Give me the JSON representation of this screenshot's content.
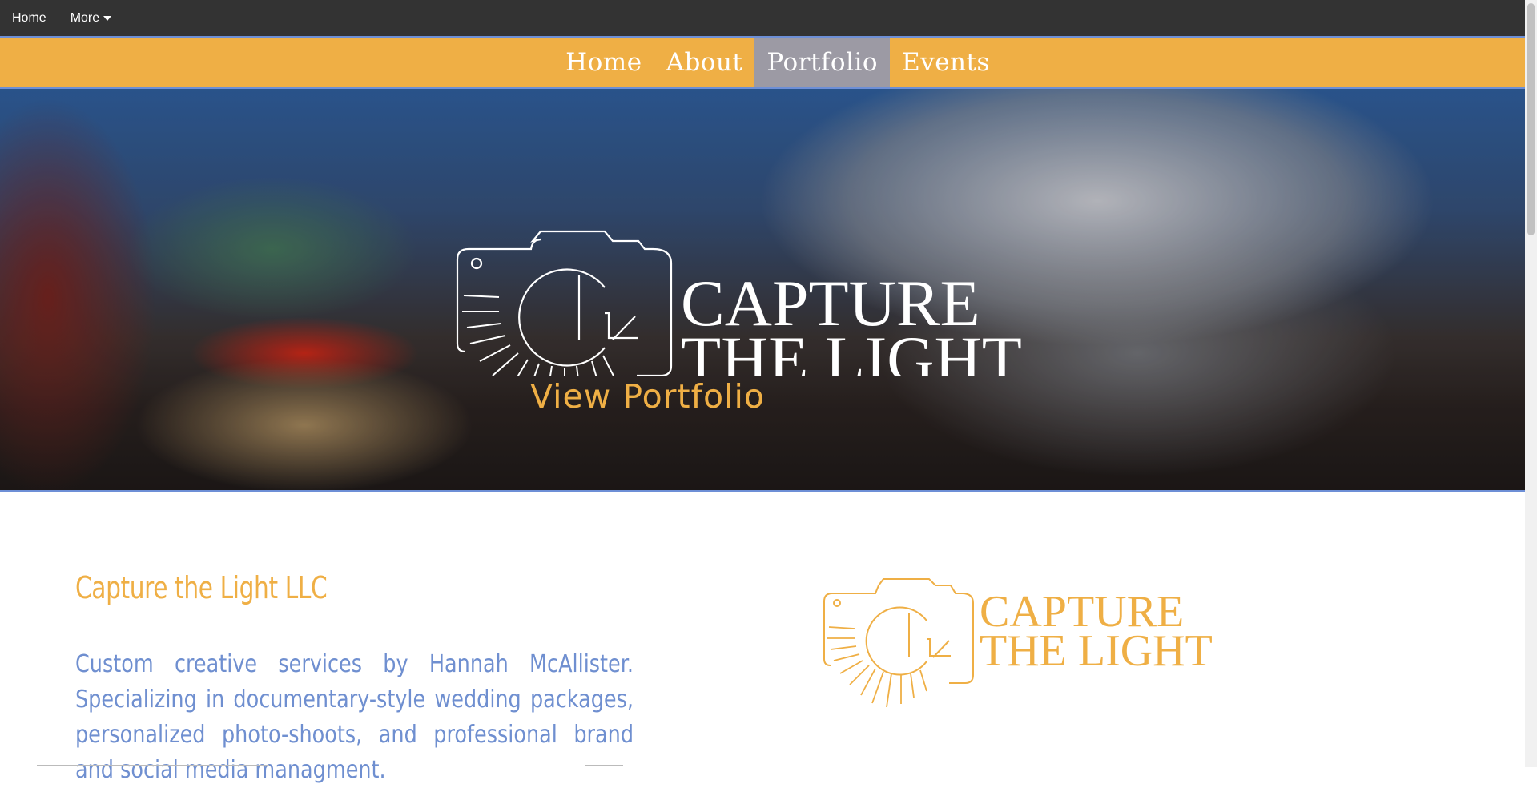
{
  "topbar": {
    "home": "Home",
    "more": "More"
  },
  "nav": {
    "items": [
      "Home",
      "About",
      "Portfolio",
      "Events"
    ],
    "active": "Portfolio"
  },
  "hero": {
    "logo_line1": "CAPTURE",
    "logo_line2": "THE LIGHT",
    "cta": "View Portfolio"
  },
  "content": {
    "title": "Capture the Light LLC",
    "text": "Custom creative services by Hannah McAllister. Specializing in documentary-style wedding packages, personalized photo-shoots, and professional brand and social media managment.",
    "logo_line1": "CAPTURE",
    "logo_line2": "THE LIGHT"
  },
  "colors": {
    "accent": "#EFAF45",
    "topbar": "#333333",
    "nav_active": "#9c9aa4",
    "body_text": "#6f8fd0"
  }
}
